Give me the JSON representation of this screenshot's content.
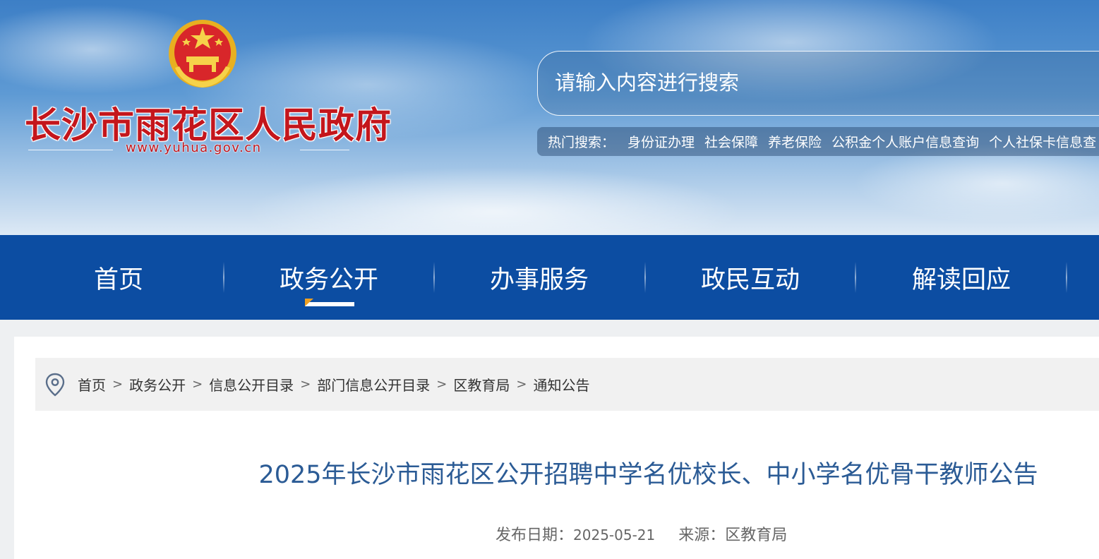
{
  "header": {
    "site_title": "长沙市雨花区人民政府",
    "site_url": "www.yuhua.gov.cn",
    "search_placeholder": "请输入内容进行搜索",
    "hot_search_label": "热门搜索：",
    "hot_search_items": [
      "身份证办理",
      "社会保障",
      "养老保险",
      "公积金个人账户信息查询",
      "个人社保卡信息查"
    ]
  },
  "nav": {
    "items": [
      "首页",
      "政务公开",
      "办事服务",
      "政民互动",
      "解读回应"
    ],
    "active_index": 1
  },
  "breadcrumb": [
    "首页",
    "政务公开",
    "信息公开目录",
    "部门信息公开目录",
    "区教育局",
    "通知公告"
  ],
  "article": {
    "title": "2025年长沙市雨花区公开招聘中学名优校长、中小学名优骨干教师公告",
    "date_label": "发布日期：",
    "date": "2025-05-21",
    "source_label": "来源：",
    "source": "区教育局"
  },
  "colors": {
    "nav_bg": "#0c4da2",
    "title_red": "#c4161c",
    "article_title_blue": "#2b5b95"
  }
}
